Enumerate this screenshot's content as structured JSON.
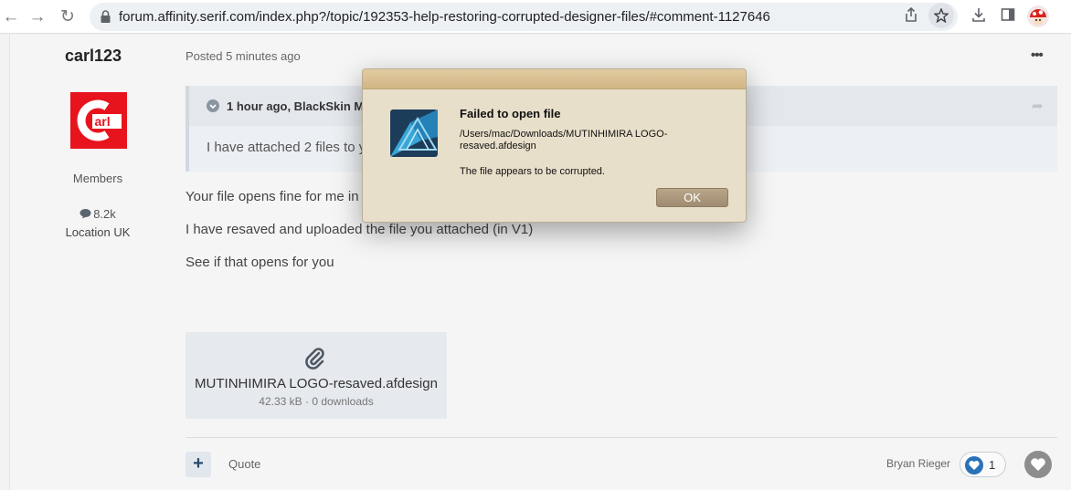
{
  "browser": {
    "url": "forum.affinity.serif.com/index.php?/topic/192353-help-restoring-corrupted-designer-files/#comment-1127646"
  },
  "author": {
    "username": "carl123",
    "logo_text": "arl",
    "group": "Members",
    "post_count": "8.2k",
    "location": "Location UK"
  },
  "post": {
    "posted": "Posted 5 minutes ago",
    "quote_author": "1 hour ago, BlackSkin Mo",
    "quote_text": "I have attached 2 files to y",
    "paragraphs": [
      "Your file opens fine for me in",
      "I have resaved and uploaded the file you attached (in V1)",
      "See if that opens for you"
    ],
    "attachment": {
      "filename": "MUTINHIMIRA LOGO-resaved.afdesign",
      "meta": "42.33 kB · 0 downloads"
    },
    "quote_label": "Quote",
    "reactor": "Bryan Rieger",
    "reaction_count": "1"
  },
  "dialog": {
    "title": "Failed to open file",
    "path": "/Users/mac/Downloads/MUTINHIMIRA LOGO-resaved.afdesign",
    "message": "The file appears to be corrupted.",
    "ok_label": "OK"
  }
}
